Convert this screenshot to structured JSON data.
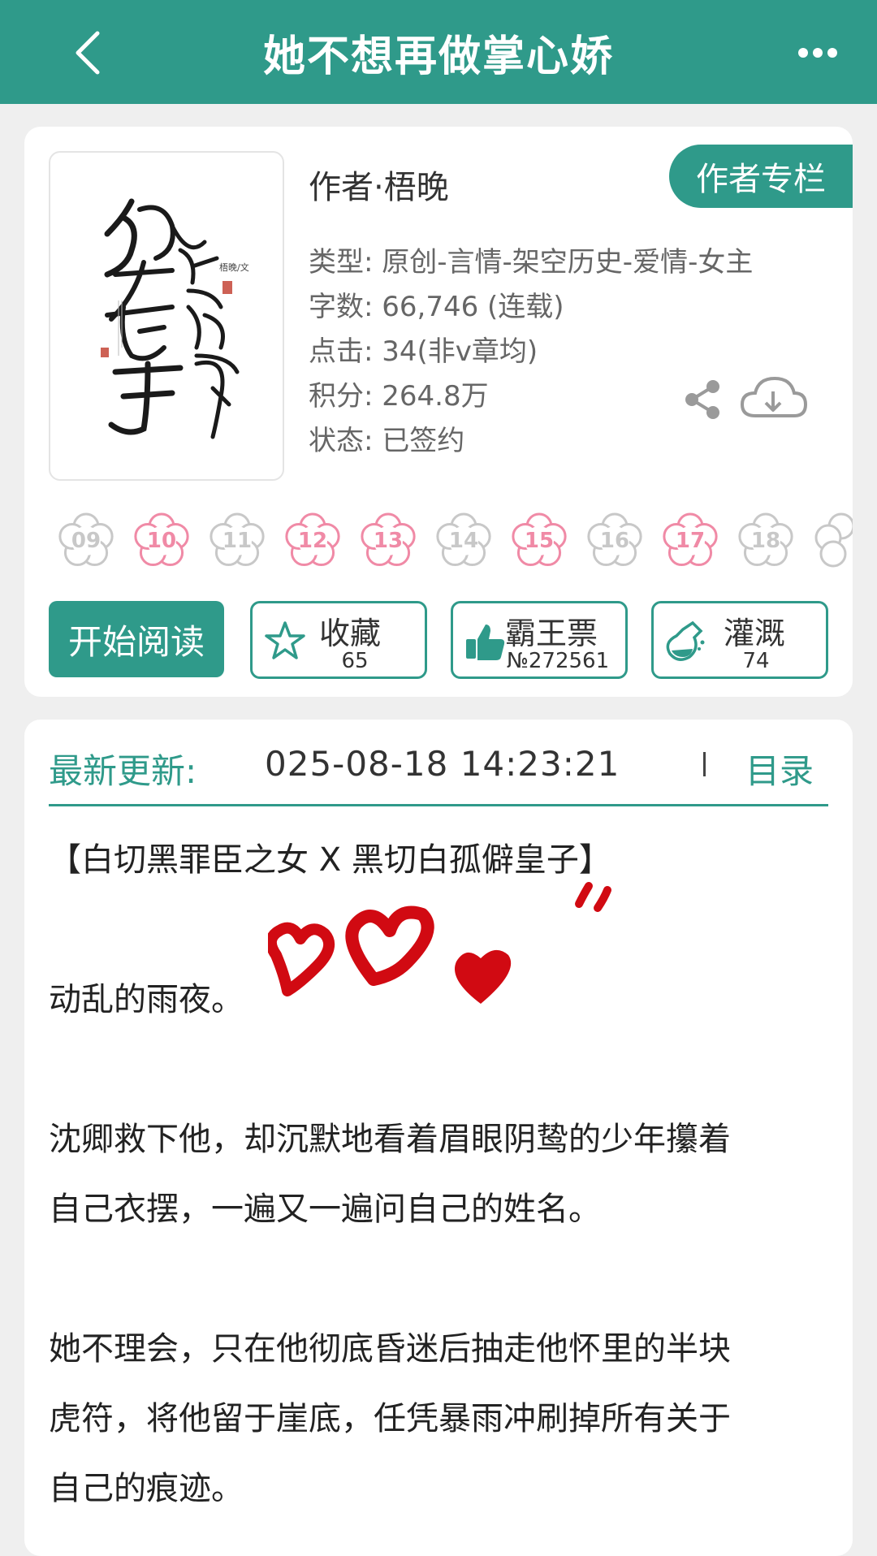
{
  "header": {
    "title": "她不想再做掌心娇"
  },
  "book": {
    "author_line": "作者·梧晚",
    "author_column_label": "作者专栏",
    "cover_alt_text": "她不想再做掌心娇",
    "cover_byline": "梧晚/文",
    "meta": [
      "类型: 原创-言情-架空历史-爱情-女主",
      "字数: 66,746 (连载)",
      "点击: 34(非v章均)",
      "积分: 264.8万",
      "状态: 已签约"
    ]
  },
  "flowers": [
    {
      "num": "09",
      "color": "#c8c8c8"
    },
    {
      "num": "10",
      "color": "#f08aa6"
    },
    {
      "num": "11",
      "color": "#c8c8c8"
    },
    {
      "num": "12",
      "color": "#f08aa6"
    },
    {
      "num": "13",
      "color": "#f08aa6"
    },
    {
      "num": "14",
      "color": "#c8c8c8"
    },
    {
      "num": "15",
      "color": "#f08aa6"
    },
    {
      "num": "16",
      "color": "#c8c8c8"
    },
    {
      "num": "17",
      "color": "#f08aa6"
    },
    {
      "num": "18",
      "color": "#c8c8c8"
    }
  ],
  "actions": {
    "read_label": "开始阅读",
    "collect_label": "收藏",
    "collect_count": "65",
    "vote_label": "霸王票",
    "vote_count": "№272561",
    "water_label": "灌溉",
    "water_count": "74"
  },
  "update": {
    "label": "最新更新:",
    "time": "025-08-18 14:23:21",
    "catalog_label": "目录"
  },
  "intro": {
    "p1": "【白切黑罪臣之女 X 黑切白孤僻皇子】",
    "p2": "动乱的雨夜。",
    "p3a": "沈卿救下他，却沉默地看着眉眼阴鸷的少年攥着",
    "p3b": "自己衣摆，一遍又一遍问自己的姓名。",
    "p4a": "她不理会，只在他彻底昏迷后抽走他怀里的半块",
    "p4b": "虎符，将他留于崖底，任凭暴雨冲刷掉所有关于",
    "p4c": "自己的痕迹。"
  },
  "colors": {
    "accent": "#2f9a8a",
    "heart": "#d10a12"
  }
}
